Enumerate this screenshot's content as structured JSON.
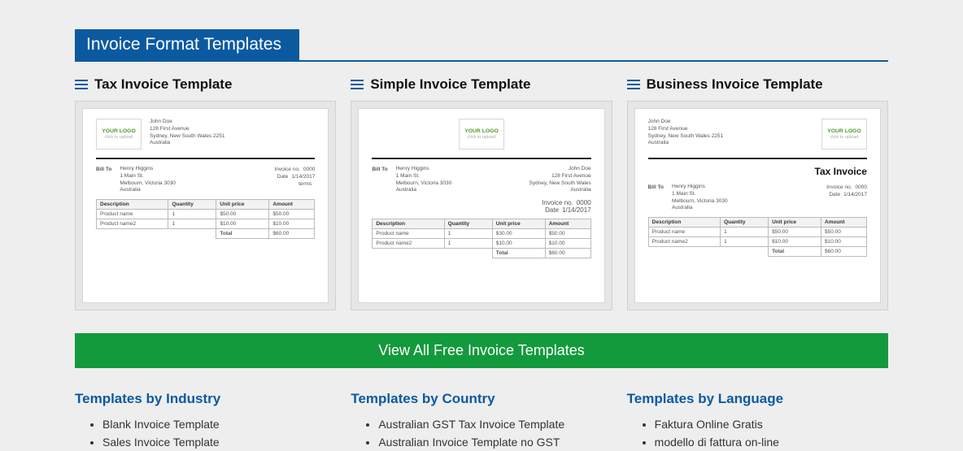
{
  "section_title": "Invoice Format Templates",
  "templates": [
    {
      "title": "Tax Invoice Template",
      "header_layout": "logo-left",
      "show_tax_title": false,
      "from": {
        "name": "John Doe",
        "line1": "128 First Avenue",
        "line2": "Sydney, New South Wales 2251",
        "country": "Australia"
      },
      "logo": {
        "title": "YOUR LOGO",
        "sub": "click to upload"
      },
      "bill_to_label": "Bill To",
      "bill_to": {
        "name": "Henry Higgins",
        "line1": "1 Main St.",
        "line2": "Melbourn, Victoria 3030",
        "country": "Australia"
      },
      "invoice_meta": {
        "no_label": "Invoice no.",
        "no": "0000",
        "date_label": "Date",
        "date": "1/14/2017",
        "terms_label": "terms"
      },
      "table": {
        "headers": [
          "Description",
          "Quantity",
          "Unit price",
          "Amount"
        ],
        "rows": [
          [
            "Product name",
            "1",
            "$50.00",
            "$50.00"
          ],
          [
            "Product name2",
            "1",
            "$10.00",
            "$10.00"
          ]
        ],
        "total_label": "Total",
        "total": "$60.00"
      }
    },
    {
      "title": "Simple Invoice Template",
      "header_layout": "logo-center",
      "show_tax_title": false,
      "from": {
        "name": "John Doe",
        "line1": "128 First Avenue",
        "line2": "Sydney, New South Wales",
        "country": "Australia"
      },
      "logo": {
        "title": "YOUR LOGO",
        "sub": "click to upload"
      },
      "bill_to_label": "Bill To",
      "bill_to": {
        "name": "Henry Higgins",
        "line1": "1 Main St.",
        "line2": "Melbourn, Victoria 3030",
        "country": "Australia"
      },
      "invoice_meta": {
        "no_label": "Invoice no.",
        "no": "0000",
        "date_label": "Date",
        "date": "1/14/2017"
      },
      "table": {
        "headers": [
          "Description",
          "Quantity",
          "Unit price",
          "Amount"
        ],
        "rows": [
          [
            "Product name",
            "1",
            "$30.00",
            "$50.00"
          ],
          [
            "Product name2",
            "1",
            "$10.00",
            "$10.00"
          ]
        ],
        "total_label": "Total",
        "total": "$60.00"
      }
    },
    {
      "title": "Business Invoice Template",
      "header_layout": "logo-right",
      "show_tax_title": true,
      "tax_title": "Tax Invoice",
      "from": {
        "name": "John Doe",
        "line1": "128 First Avenue",
        "line2": "Sydney, New South Wales 2251",
        "country": "Australia"
      },
      "logo": {
        "title": "YOUR LOGO",
        "sub": "click to upload"
      },
      "bill_to_label": "Bill To",
      "bill_to": {
        "name": "Henry Higgins",
        "line1": "1 Main St.",
        "line2": "Melbourn, Victoria 3030",
        "country": "Australia"
      },
      "invoice_meta": {
        "no_label": "Invoice no.",
        "no": "0000",
        "date_label": "Date",
        "date": "1/14/2017"
      },
      "table": {
        "headers": [
          "Description",
          "Quantity",
          "Unit price",
          "Amount"
        ],
        "rows": [
          [
            "Product name",
            "1",
            "$50.00",
            "$50.00"
          ],
          [
            "Product name2",
            "1",
            "$10.00",
            "$10.00"
          ]
        ],
        "total_label": "Total",
        "total": "$60.00"
      }
    }
  ],
  "cta_label": "View All Free Invoice Templates",
  "lists": [
    {
      "heading": "Templates by Industry",
      "items": [
        "Blank Invoice Template",
        "Sales Invoice Template"
      ]
    },
    {
      "heading": "Templates by Country",
      "items": [
        "Australian GST Tax Invoice Template",
        "Australian Invoice Template no GST"
      ]
    },
    {
      "heading": "Templates by Language",
      "items": [
        "Faktura Online Gratis",
        "modello di fattura on-line"
      ]
    }
  ]
}
